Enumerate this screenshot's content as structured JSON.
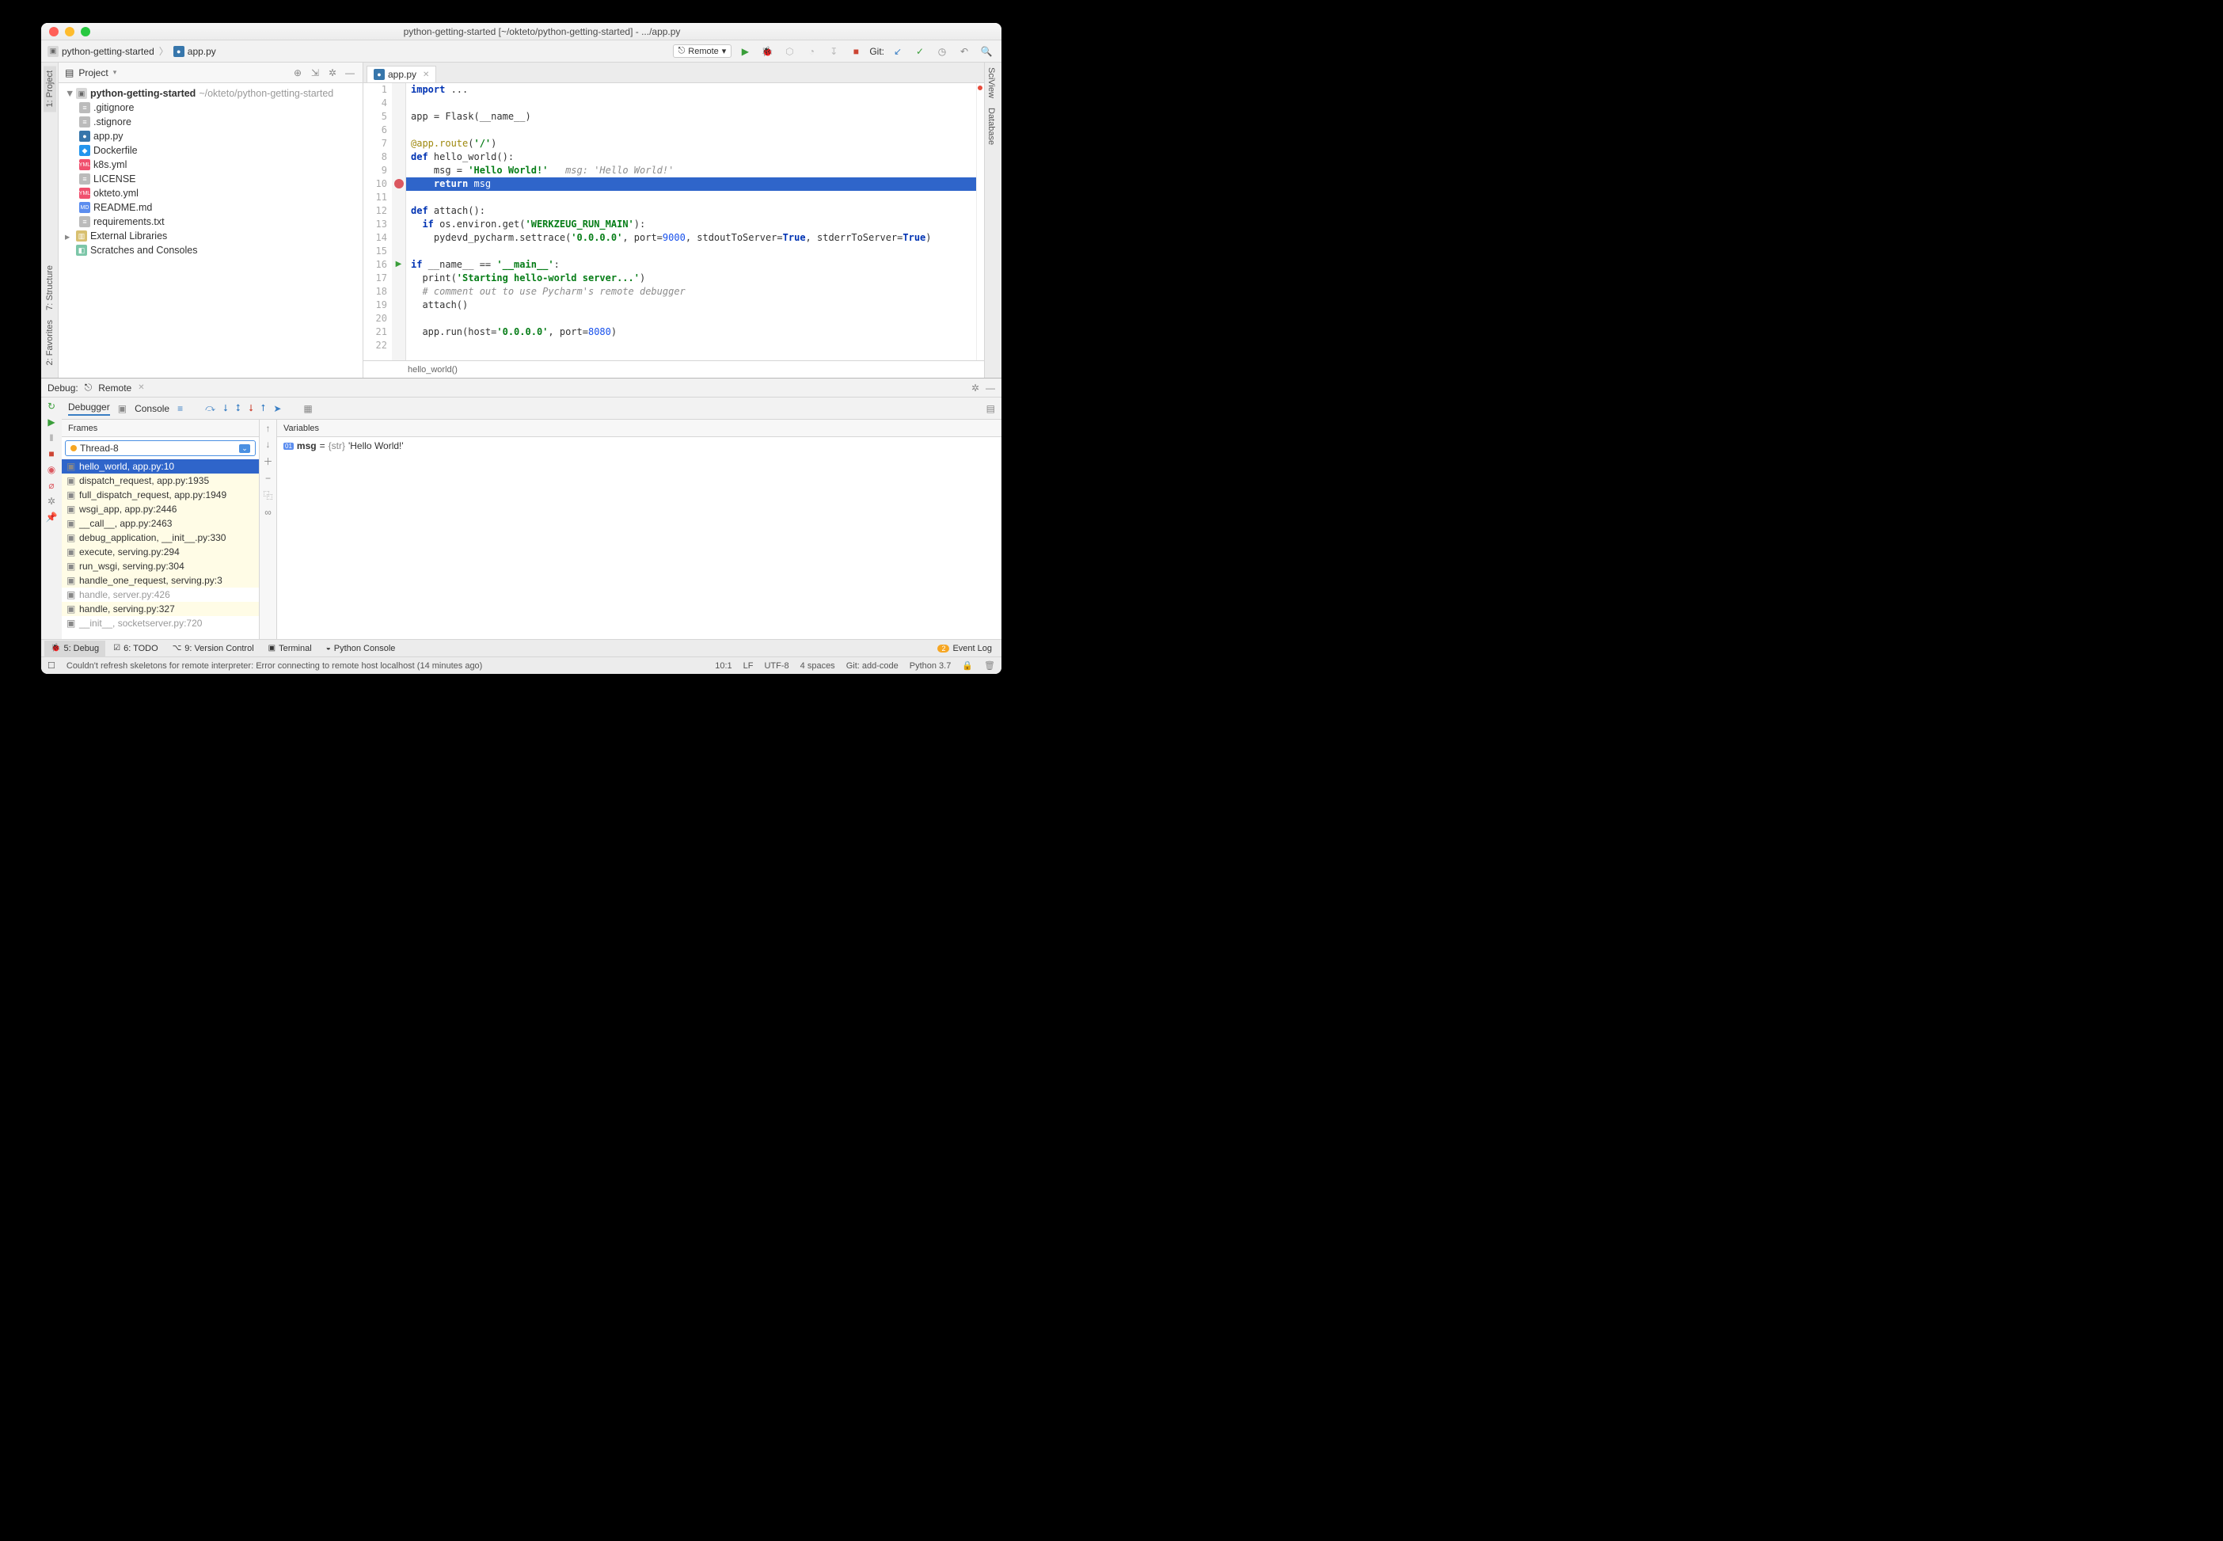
{
  "window": {
    "title": "python-getting-started [~/okteto/python-getting-started] - .../app.py"
  },
  "breadcrumb": {
    "folder": "python-getting-started",
    "file": "app.py"
  },
  "toolbar": {
    "run_config": "Remote",
    "git_label": "Git:"
  },
  "project_tool": {
    "title": "Project",
    "root": "python-getting-started",
    "root_path": "~/okteto/python-getting-started",
    "files": [
      {
        "name": ".gitignore",
        "icon": "git"
      },
      {
        "name": ".stignore",
        "icon": "txt"
      },
      {
        "name": "app.py",
        "icon": "py"
      },
      {
        "name": "Dockerfile",
        "icon": "docker"
      },
      {
        "name": "k8s.yml",
        "icon": "yml"
      },
      {
        "name": "LICENSE",
        "icon": "txt"
      },
      {
        "name": "okteto.yml",
        "icon": "yml"
      },
      {
        "name": "README.md",
        "icon": "md"
      },
      {
        "name": "requirements.txt",
        "icon": "txt"
      }
    ],
    "ext_lib": "External Libraries",
    "scratches": "Scratches and Consoles"
  },
  "editor": {
    "tab": "app.py",
    "breadcrumb_fn": "hello_world()",
    "lines": {
      "l1a": "import",
      "l1b": " ...",
      "l5": "app = Flask(__name__)",
      "l7a": "@app.route",
      "l7b": "(",
      "l7c": "'/'",
      "l7d": ")",
      "l8a": "def",
      "l8b": " hello_world():",
      "l9a": "    msg = ",
      "l9b": "'Hello World!'",
      "l9c": "   msg: 'Hello World!'",
      "l10a": "    return",
      "l10b": " msg",
      "l12a": "def",
      "l12b": " attach():",
      "l13a": "  if",
      "l13b": " os.environ.get(",
      "l13c": "'WERKZEUG_RUN_MAIN'",
      "l13d": "):",
      "l14a": "    pydevd_pycharm.settrace(",
      "l14b": "'0.0.0.0'",
      "l14c": ", port=",
      "l14d": "9000",
      "l14e": ", stdoutToServer=",
      "l14f": "True",
      "l14g": ", stderrToServer=",
      "l14h": "True",
      "l14i": ")",
      "l16a": "if",
      "l16b": " __name__ == ",
      "l16c": "'__main__'",
      "l16d": ":",
      "l17a": "  print(",
      "l17b": "'Starting hello-world server...'",
      "l17c": ")",
      "l18": "  # comment out to use Pycharm's remote debugger",
      "l19": "  attach()",
      "l21a": "  app.run(host=",
      "l21b": "'0.0.0.0'",
      "l21c": ", port=",
      "l21d": "8080",
      "l21e": ")"
    }
  },
  "side_tabs": {
    "project": "1: Project",
    "structure": "7: Structure",
    "favorites": "2: Favorites",
    "sciview": "SciView",
    "database": "Database"
  },
  "debug": {
    "label": "Debug:",
    "config": "Remote",
    "debugger_tab": "Debugger",
    "console_tab": "Console",
    "frames_hd": "Frames",
    "vars_hd": "Variables",
    "thread": "Thread-8",
    "frames": [
      "hello_world, app.py:10",
      "dispatch_request, app.py:1935",
      "full_dispatch_request, app.py:1949",
      "wsgi_app, app.py:2446",
      "__call__, app.py:2463",
      "debug_application, __init__.py:330",
      "execute, serving.py:294",
      "run_wsgi, serving.py:304",
      "handle_one_request, serving.py:3",
      "handle, server.py:426",
      "handle, serving.py:327",
      "__init__, socketserver.py:720"
    ],
    "var_name": "msg",
    "var_type": "{str}",
    "var_val": "'Hello World!'"
  },
  "bottom_tabs": {
    "debug": "5: Debug",
    "todo": "6: TODO",
    "vcs": "9: Version Control",
    "terminal": "Terminal",
    "pyconsole": "Python Console",
    "eventlog": "Event Log",
    "eventcount": "2"
  },
  "status": {
    "msg": "Couldn't refresh skeletons for remote interpreter: Error connecting to remote host localhost (14 minutes ago)",
    "pos": "10:1",
    "le": "LF",
    "enc": "UTF-8",
    "indent": "4 spaces",
    "branch": "Git: add-code",
    "interp": "Python 3.7"
  }
}
